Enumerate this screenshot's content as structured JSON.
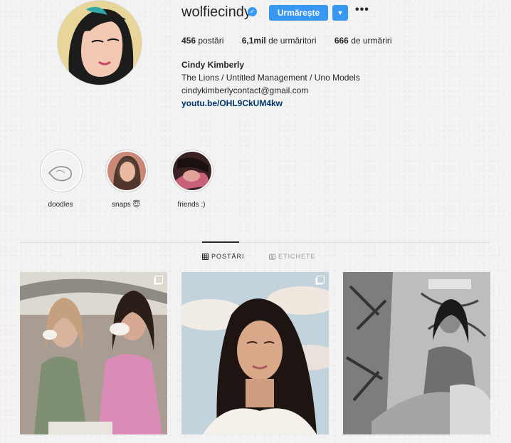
{
  "profile": {
    "username": "wolfiecindy",
    "follow_label": "Urmărește",
    "more_label": "•••",
    "stats": [
      {
        "value": "456",
        "label": "postări"
      },
      {
        "value": "6,1mil",
        "label": "de urmăritori"
      },
      {
        "value": "666",
        "label": "de urmăriri"
      }
    ],
    "bio": {
      "name": "Cindy Kimberly",
      "line1": "The Lions / Untitled Management / Uno Models",
      "email": "cindykimberlycontact@gmail.com",
      "link": "youtu.be/OHL9CkUM4kw"
    }
  },
  "highlights": [
    {
      "label": "doodles"
    },
    {
      "label": "snaps 😇"
    },
    {
      "label": "friends :)"
    }
  ],
  "tabs": {
    "posts": "POSTĂRI",
    "tagged": "ETICHETE"
  },
  "colors": {
    "accent": "#3897f0",
    "link": "#003569",
    "text": "#262626"
  },
  "icons": [
    "verified-badge-icon",
    "chevron-down-icon",
    "more-options-icon",
    "grid-icon",
    "tagged-icon",
    "multiple-posts-icon"
  ]
}
